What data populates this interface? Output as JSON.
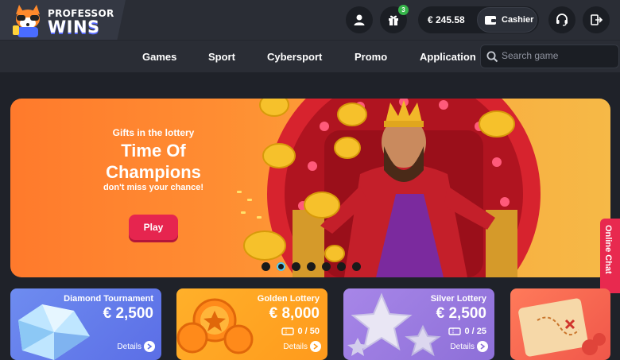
{
  "brand": {
    "line1": "PROFESSOR",
    "line2": "WINS"
  },
  "header": {
    "gift_badge": "3",
    "balance": "€ 245.58",
    "cashier_label": "Cashier"
  },
  "nav": {
    "items": [
      {
        "label": "Games"
      },
      {
        "label": "Sport"
      },
      {
        "label": "Cybersport"
      },
      {
        "label": "Promo"
      },
      {
        "label": "Application"
      }
    ],
    "search_placeholder": "Search game"
  },
  "banner": {
    "subtitle": "Gifts in the lottery",
    "title_line1": "Time Of",
    "title_line2": "Champions",
    "tagline": "don't miss your chance!",
    "play_label": "Play",
    "slide_count": 7,
    "active_slide": 2
  },
  "online_chat": "Online Chat",
  "cards": [
    {
      "title": "Diamond Tournament",
      "amount": "€ 2,500",
      "count": "",
      "details": "Details"
    },
    {
      "title": "Golden Lottery",
      "amount": "€ 8,000",
      "count": "0 / 50",
      "details": "Details"
    },
    {
      "title": "Silver Lottery",
      "amount": "€ 2,500",
      "count": "0 / 25",
      "details": "Details"
    }
  ],
  "colors": {
    "accent_red": "#e6254f",
    "header_bg": "#2a2d35",
    "badge_green": "#36b54a"
  }
}
